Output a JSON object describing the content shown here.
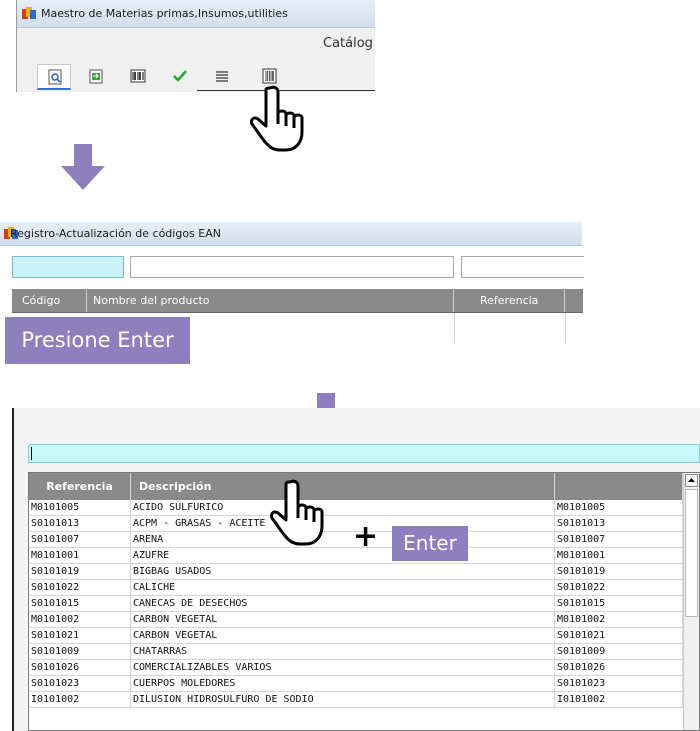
{
  "panel1": {
    "window_title": "Maestro de Materias primas,Insumos,utilities",
    "catalog_tab_label": "Catálog",
    "toolbar_icons": [
      "preview-icon",
      "export-icon",
      "barcode-icon",
      "check-icon",
      "list-icon",
      "ean-barcode-icon"
    ]
  },
  "panel2": {
    "window_title": "Registro-Actualización de códigos EAN",
    "columns": [
      "Código",
      "Nombre del producto",
      "Referencia"
    ],
    "instruction_label": "Presione Enter"
  },
  "panel3": {
    "search_value": "",
    "columns": [
      "Referencia",
      "Descripción",
      ""
    ],
    "rows": [
      [
        "M0101005",
        "ACIDO SULFURICO",
        "M0101005"
      ],
      [
        "S0101013",
        "ACPM - GRASAS - ACEITE",
        "S0101013"
      ],
      [
        "S0101007",
        "ARENA",
        "S0101007"
      ],
      [
        "M0101001",
        "AZUFRE",
        "M0101001"
      ],
      [
        "S0101019",
        "BIGBAG USADOS",
        "S0101019"
      ],
      [
        "S0101022",
        "CALICHE",
        "S0101022"
      ],
      [
        "S0101015",
        "CANECAS DE DESECHOS",
        "S0101015"
      ],
      [
        "M0101002",
        "CARBON VEGETAL",
        "M0101002"
      ],
      [
        "S0101021",
        "CARBON VEGETAL",
        "S0101021"
      ],
      [
        "S0101009",
        "CHATARRAS",
        "S0101009"
      ],
      [
        "S0101026",
        "COMERCIALIZABLES VARIOS",
        "S0101026"
      ],
      [
        "S0101023",
        "CUERPOS MOLEDORES",
        "S0101023"
      ],
      [
        "I0101002",
        "DILUSION HIDROSULFURO DE SODIO",
        "I0101002"
      ]
    ],
    "plus_label": "+",
    "enter_label": "Enter"
  },
  "colors": {
    "instruction_bg": "#8e80bf",
    "arrow": "#8e80bf",
    "search_bg": "#c9f8fb",
    "header_bg": "#8a8a8a"
  }
}
